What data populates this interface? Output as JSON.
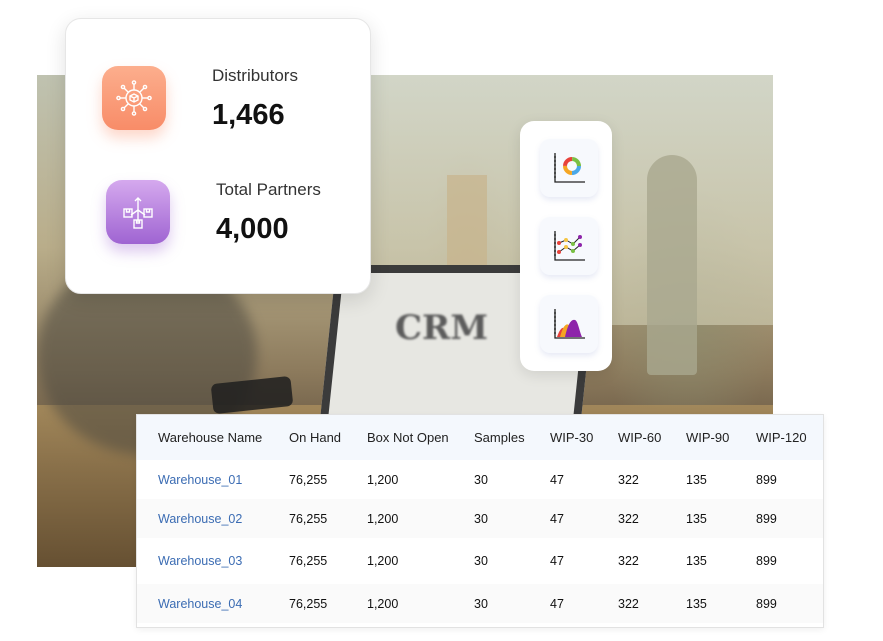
{
  "background": {
    "photo_text": "CRM"
  },
  "stats": [
    {
      "label": "Distributors",
      "value": "1,466",
      "icon": "network-box-icon",
      "color": "#f88c68"
    },
    {
      "label": "Total Partners",
      "value": "4,000",
      "icon": "distribution-boxes-icon",
      "color": "#9f64d2"
    }
  ],
  "chart_buttons": [
    {
      "name": "donut-chart-icon"
    },
    {
      "name": "line-chart-icon"
    },
    {
      "name": "area-chart-icon"
    }
  ],
  "table": {
    "headers": [
      "Warehouse Name",
      "On Hand",
      "Box Not Open",
      "Samples",
      "WIP-30",
      "WIP-60",
      "WIP-90",
      "WIP-120"
    ],
    "rows": [
      [
        "Warehouse_01",
        "76,255",
        "1,200",
        "30",
        "47",
        "322",
        "135",
        "899"
      ],
      [
        "Warehouse_02",
        "76,255",
        "1,200",
        "30",
        "47",
        "322",
        "135",
        "899"
      ],
      [
        "Warehouse_03",
        "76,255",
        "1,200",
        "30",
        "47",
        "322",
        "135",
        "899"
      ],
      [
        "Warehouse_04",
        "76,255",
        "1,200",
        "30",
        "47",
        "322",
        "135",
        "899"
      ]
    ],
    "link_color": "#3b6cb3"
  }
}
